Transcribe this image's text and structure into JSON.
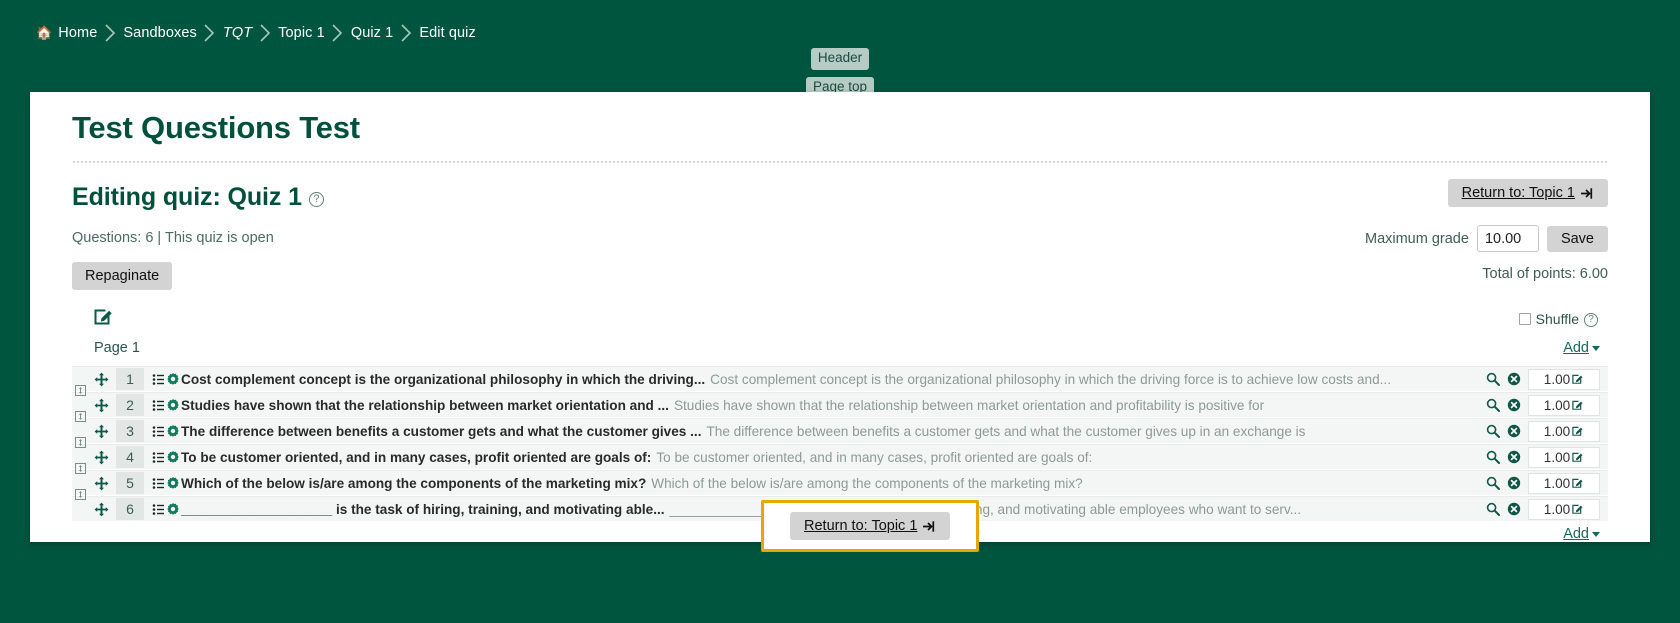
{
  "breadcrumb": {
    "name": "breadcrumb",
    "items": [
      {
        "label": "Home",
        "icon": "home-icon",
        "italic": false
      },
      {
        "label": "Sandboxes",
        "icon": null,
        "italic": false
      },
      {
        "label": "TQT",
        "icon": null,
        "italic": true
      },
      {
        "label": "Topic 1",
        "icon": null,
        "italic": false
      },
      {
        "label": "Quiz 1",
        "icon": null,
        "italic": false
      },
      {
        "label": "Edit quiz",
        "icon": null,
        "italic": false
      }
    ]
  },
  "skip_links": [
    {
      "label": "Header"
    },
    {
      "label": "Page top"
    }
  ],
  "site": {
    "title": "Test Questions Test"
  },
  "header": {
    "page_heading": "Editing quiz: Quiz 1",
    "help_glyph": "?",
    "return_top_label": "Return to: Topic 1",
    "return_icon": "sign-in-arrow-icon"
  },
  "info": {
    "questions_meta": "Questions: 6 | This quiz is open",
    "repaginate_label": "Repaginate",
    "maximum_grade_label": "Maximum grade",
    "maximum_grade_value": "10.00",
    "save_label": "Save",
    "total_points": "Total of points: 6.00"
  },
  "panel": {
    "edit_icon": "pencil-square-icon",
    "shuffle_label": "Shuffle",
    "shuffle_checked": false,
    "shuffle_help_glyph": "?",
    "page_label": "Page 1",
    "add_label": "Add",
    "add_bottom_label": "Add"
  },
  "questions": [
    {
      "num": "1",
      "title": "Cost complement concept is the organizational philosophy in which the driving...",
      "description": "Cost complement concept is the organizational philosophy in which the driving force is to achieve low costs and...",
      "mark": "1.00"
    },
    {
      "num": "2",
      "title": "Studies have shown that the relationship between market orientation and ...",
      "description": "Studies have shown that the relationship between market orientation and profitability is positive for",
      "mark": "1.00"
    },
    {
      "num": "3",
      "title": "The difference between benefits a customer gets and what the customer gives ...",
      "description": "The difference between benefits a customer gets and what the customer gives up in an exchange is",
      "mark": "1.00"
    },
    {
      "num": "4",
      "title": "To be customer oriented, and in many cases, profit oriented are goals of:",
      "description": "To be customer oriented, and in many cases, profit oriented are goals of:",
      "mark": "1.00"
    },
    {
      "num": "5",
      "title": "Which of the below is/are among the components of the marketing mix?",
      "description": "Which of the below is/are among the components of the marketing mix?",
      "mark": "1.00"
    },
    {
      "num": "6",
      "title": "____________________ is the task of hiring, training, and motivating able...",
      "description": "____________________ is the task of hiring, training, and motivating able employees who want to serv...",
      "mark": "1.00"
    }
  ],
  "footer": {
    "return_bottom_label": "Return to: Topic 1",
    "return_icon": "sign-in-arrow-icon"
  },
  "colors": {
    "brand_green": "#00553f",
    "heading_green": "#00503c",
    "highlight_gold": "#e8a700",
    "button_grey": "#d3d3d3"
  }
}
